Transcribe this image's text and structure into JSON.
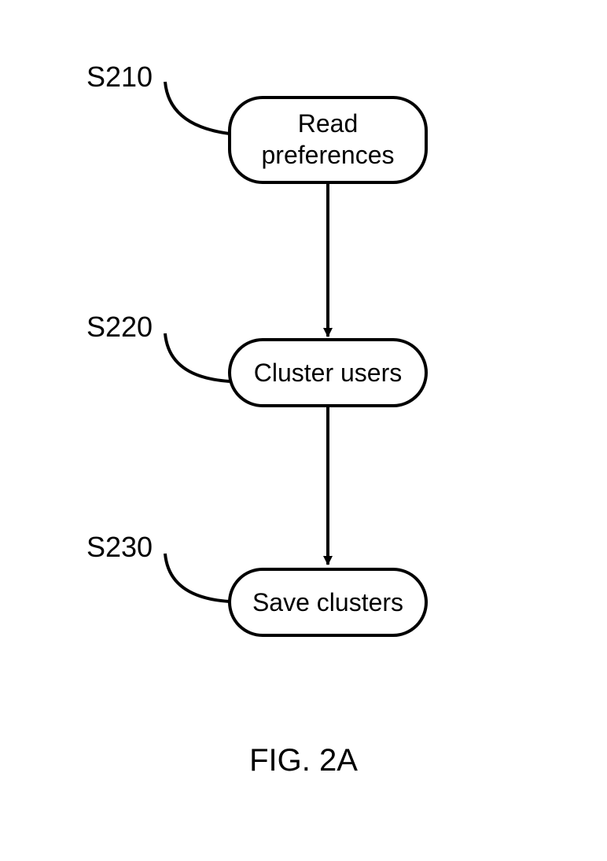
{
  "nodes": {
    "step1": {
      "id": "S210",
      "label_line1": "Read",
      "label_line2": "preferences"
    },
    "step2": {
      "id": "S220",
      "label_line1": "Cluster users",
      "label_line2": ""
    },
    "step3": {
      "id": "S230",
      "label_line1": "Save clusters",
      "label_line2": ""
    }
  },
  "caption": "FIG. 2A"
}
